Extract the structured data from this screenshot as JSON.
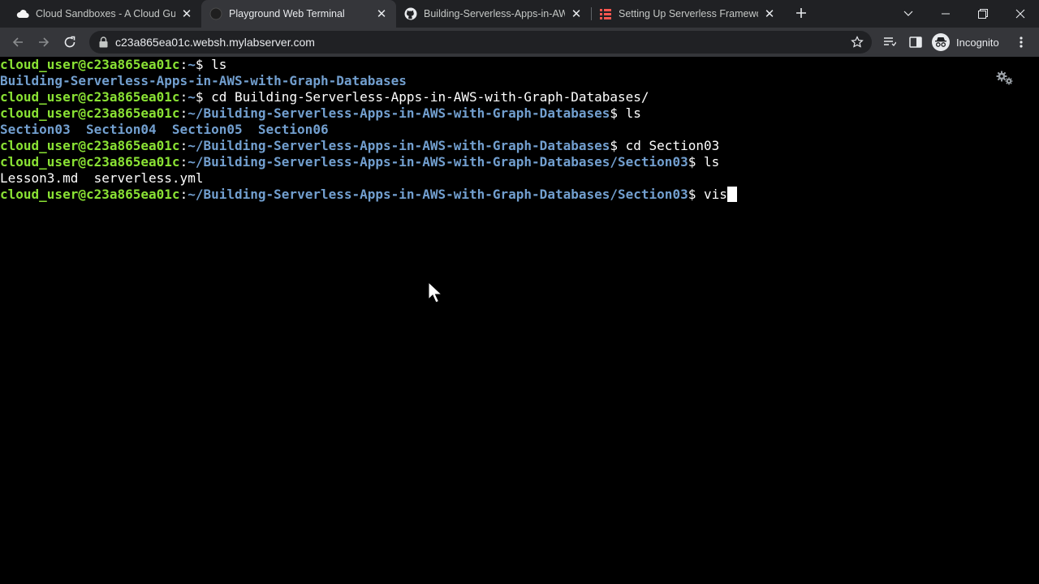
{
  "tabs": [
    {
      "title": "Cloud Sandboxes - A Cloud Guru",
      "favicon": "cloud-icon"
    },
    {
      "title": "Playground Web Terminal",
      "favicon": "terminal-icon",
      "active": true
    },
    {
      "title": "Building-Serverless-Apps-in-AWS",
      "favicon": "github-icon"
    },
    {
      "title": "Setting Up Serverless Framework",
      "favicon": "serverless-icon"
    }
  ],
  "address_bar": {
    "url": "c23a865ea01c.websh.mylabserver.com"
  },
  "profile": {
    "label": "Incognito"
  },
  "terminal": {
    "lines": [
      {
        "prompt_user": "cloud_user@c23a865ea01c",
        "prompt_sep": ":",
        "prompt_path": "~",
        "prompt_end": "$ ",
        "command": "ls"
      },
      {
        "output_dir": "Building-Serverless-Apps-in-AWS-with-Graph-Databases"
      },
      {
        "prompt_user": "cloud_user@c23a865ea01c",
        "prompt_sep": ":",
        "prompt_path": "~",
        "prompt_end": "$ ",
        "command": "cd Building-Serverless-Apps-in-AWS-with-Graph-Databases/"
      },
      {
        "prompt_user": "cloud_user@c23a865ea01c",
        "prompt_sep": ":",
        "prompt_path": "~/Building-Serverless-Apps-in-AWS-with-Graph-Databases",
        "prompt_end": "$ ",
        "command": "ls"
      },
      {
        "output_dir": "Section03  Section04  Section05  Section06"
      },
      {
        "prompt_user": "cloud_user@c23a865ea01c",
        "prompt_sep": ":",
        "prompt_path": "~/Building-Serverless-Apps-in-AWS-with-Graph-Databases",
        "prompt_end": "$ ",
        "command": "cd Section03"
      },
      {
        "prompt_user": "cloud_user@c23a865ea01c",
        "prompt_sep": ":",
        "prompt_path": "~/Building-Serverless-Apps-in-AWS-with-Graph-Databases/Section03",
        "prompt_end": "$ ",
        "command": "ls"
      },
      {
        "output_file": "Lesson3.md  serverless.yml"
      },
      {
        "prompt_user": "cloud_user@c23a865ea01c",
        "prompt_sep": ":",
        "prompt_path": "~/Building-Serverless-Apps-in-AWS-with-Graph-Databases/Section03",
        "prompt_end": "$ ",
        "command": "vis"
      }
    ]
  },
  "colors": {
    "prompt_user": "#8ae234",
    "prompt_path": "#729fcf",
    "terminal_bg": "#000000",
    "tab_strip": "#202124",
    "toolbar": "#35363a"
  }
}
